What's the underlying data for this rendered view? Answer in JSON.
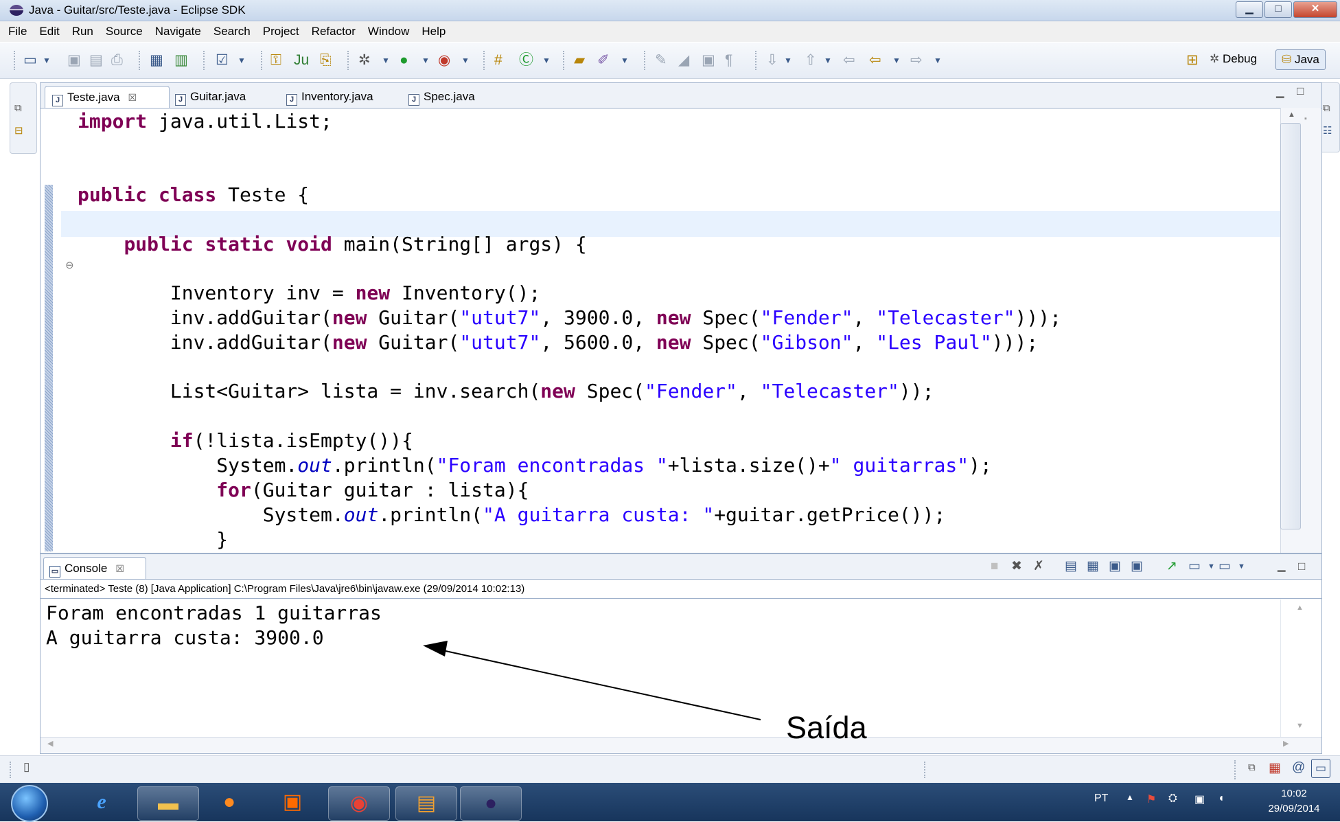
{
  "window": {
    "title": "Java - Guitar/src/Teste.java - Eclipse SDK",
    "min": "▁",
    "max": "□",
    "close": "✕"
  },
  "menu": [
    "File",
    "Edit",
    "Run",
    "Source",
    "Navigate",
    "Search",
    "Project",
    "Refactor",
    "Window",
    "Help"
  ],
  "perspectives": {
    "debug": "Debug",
    "java": "Java"
  },
  "tabs": [
    {
      "label": "Teste.java",
      "close": "☒"
    },
    {
      "label": "Guitar.java"
    },
    {
      "label": "Inventory.java"
    },
    {
      "label": "Spec.java"
    }
  ],
  "code": {
    "l1_kw": "import",
    "l1_rest": " java.util.List;",
    "l2_kw": "public class",
    "l2_rest": " Teste {",
    "l3_indent": "    ",
    "l3_kw": "public static void",
    "l3_rest": " main(String[] args) {",
    "l4_pre": "        Inventory inv = ",
    "l4_kw": "new",
    "l4_rest": " Inventory();",
    "l5_pre": "        inv.addGuitar(",
    "l5_kw1": "new",
    "l5_a": " Guitar(",
    "l5_s1": "\"utut7\"",
    "l5_b": ", 3900.0, ",
    "l5_kw2": "new",
    "l5_c": " Spec(",
    "l5_s2": "\"Fender\"",
    "l5_d": ", ",
    "l5_s3": "\"Telecaster\"",
    "l5_e": ")));",
    "l6_pre": "        inv.addGuitar(",
    "l6_kw1": "new",
    "l6_a": " Guitar(",
    "l6_s1": "\"utut7\"",
    "l6_b": ", 5600.0, ",
    "l6_kw2": "new",
    "l6_c": " Spec(",
    "l6_s2": "\"Gibson\"",
    "l6_d": ", ",
    "l6_s3": "\"Les Paul\"",
    "l6_e": ")));",
    "l7_pre": "        List<Guitar> lista = inv.search(",
    "l7_kw": "new",
    "l7_a": " Spec(",
    "l7_s1": "\"Fender\"",
    "l7_b": ", ",
    "l7_s2": "\"Telecaster\"",
    "l7_c": "));",
    "l8_indent": "        ",
    "l8_kw": "if",
    "l8_rest": "(!lista.isEmpty()){",
    "l9_pre": "            System.",
    "l9_fld": "out",
    "l9_a": ".println(",
    "l9_s1": "\"Foram encontradas \"",
    "l9_b": "+lista.size()+",
    "l9_s2": "\" guitarras\"",
    "l9_c": ");",
    "l10_indent": "            ",
    "l10_kw": "for",
    "l10_rest": "(Guitar guitar : lista){",
    "l11_pre": "                System.",
    "l11_fld": "out",
    "l11_a": ".println(",
    "l11_s1": "\"A guitarra custa: \"",
    "l11_b": "+guitar.getPrice());",
    "l12": "            }"
  },
  "console": {
    "tab": "Console",
    "tab_close": "☒",
    "header": "<terminated> Teste (8) [Java Application] C:\\Program Files\\Java\\jre6\\bin\\javaw.exe (29/09/2014 10:02:13)",
    "lines": [
      "Foram encontradas 1 guitarras",
      "A guitarra custa: 3900.0"
    ]
  },
  "annotation": "Saída",
  "taskbar": {
    "lang": "PT",
    "time": "10:02",
    "date": "29/09/2014"
  }
}
